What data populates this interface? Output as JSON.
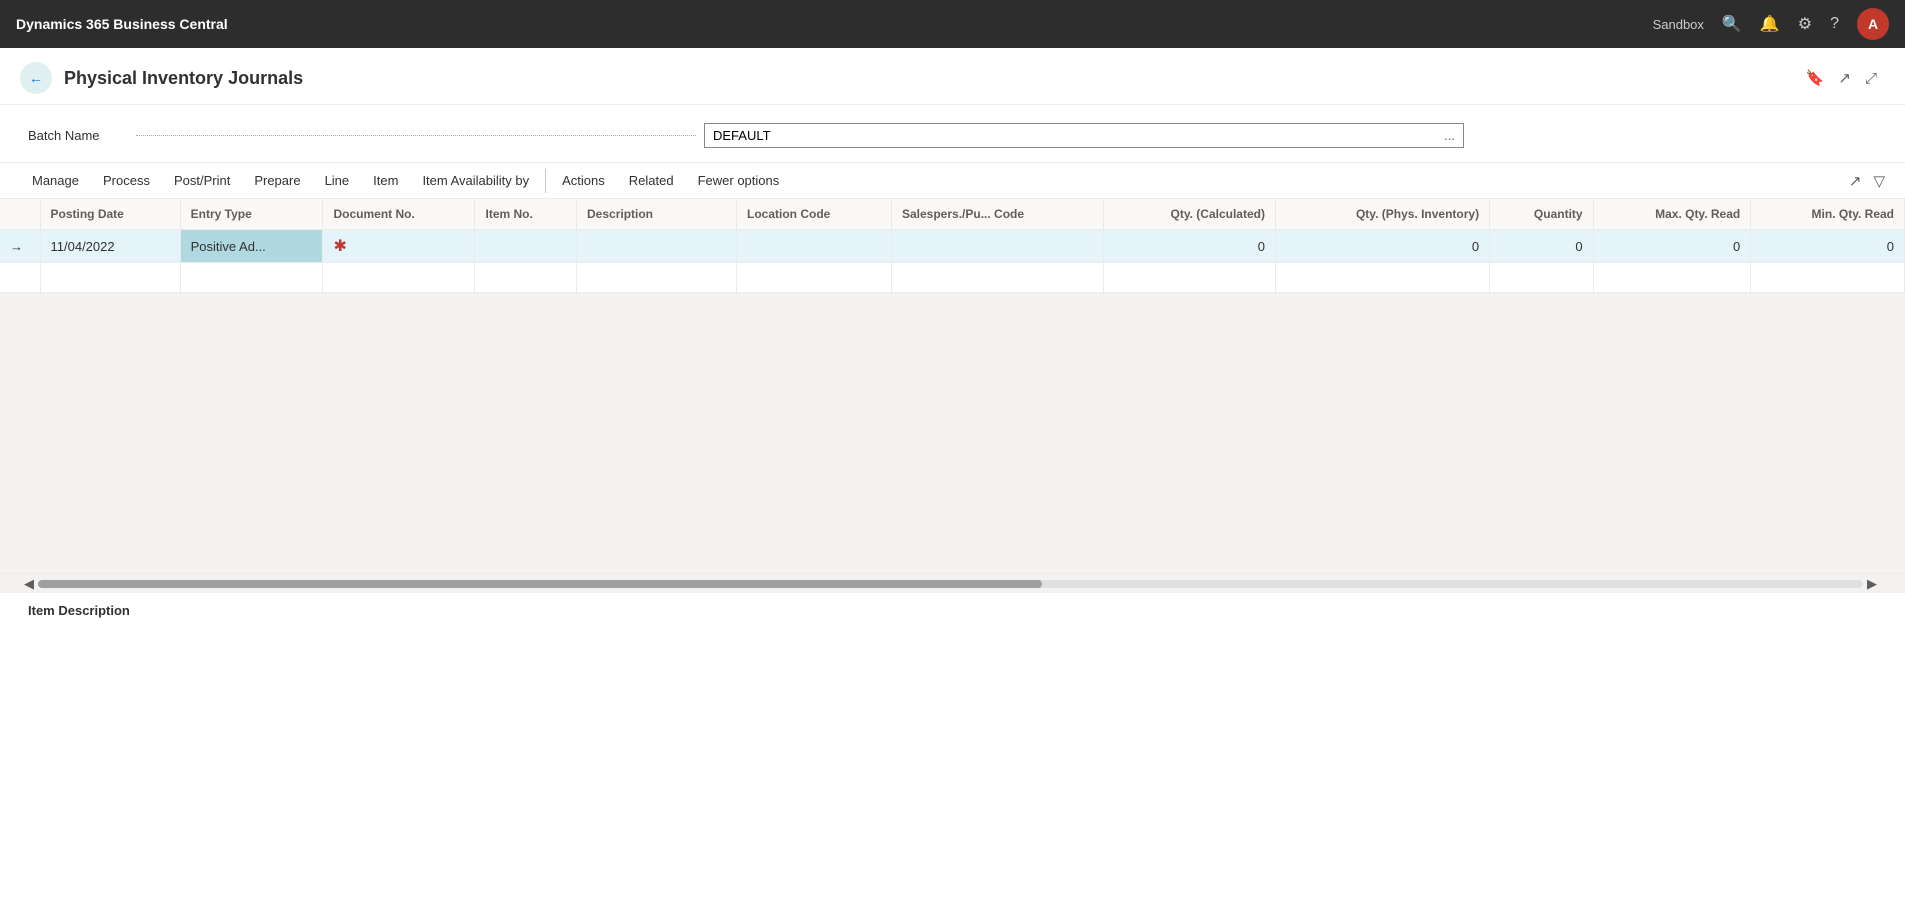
{
  "topbar": {
    "brand": "Dynamics 365 Business Central",
    "sandbox_label": "Sandbox",
    "avatar_letter": "A"
  },
  "page": {
    "title": "Physical Inventory Journals",
    "back_label": "←"
  },
  "batch": {
    "label": "Batch Name",
    "value": "DEFAULT",
    "ellipsis": "..."
  },
  "toolbar": {
    "items": [
      {
        "id": "manage",
        "label": "Manage"
      },
      {
        "id": "process",
        "label": "Process"
      },
      {
        "id": "postprint",
        "label": "Post/Print"
      },
      {
        "id": "prepare",
        "label": "Prepare"
      },
      {
        "id": "line",
        "label": "Line"
      },
      {
        "id": "item",
        "label": "Item"
      },
      {
        "id": "item-availability",
        "label": "Item Availability by"
      },
      {
        "id": "actions",
        "label": "Actions"
      },
      {
        "id": "related",
        "label": "Related"
      },
      {
        "id": "fewer-options",
        "label": "Fewer options"
      }
    ]
  },
  "table": {
    "columns": [
      {
        "id": "arrow",
        "label": ""
      },
      {
        "id": "posting-date",
        "label": "Posting Date"
      },
      {
        "id": "entry-type",
        "label": "Entry Type"
      },
      {
        "id": "document-no",
        "label": "Document No."
      },
      {
        "id": "item-no",
        "label": "Item No."
      },
      {
        "id": "description",
        "label": "Description"
      },
      {
        "id": "location-code",
        "label": "Location Code"
      },
      {
        "id": "salesperson-code",
        "label": "Salespers./Pu... Code"
      },
      {
        "id": "qty-calculated",
        "label": "Qty. (Calculated)"
      },
      {
        "id": "qty-phys-inventory",
        "label": "Qty. (Phys. Inventory)"
      },
      {
        "id": "quantity",
        "label": "Quantity"
      },
      {
        "id": "max-qty-read",
        "label": "Max. Qty. Read"
      },
      {
        "id": "min-qty-read",
        "label": "Min. Qty. Read"
      }
    ],
    "rows": [
      {
        "selected": true,
        "arrow": "→",
        "posting_date": "11/04/2022",
        "entry_type": "Positive Ad...",
        "document_no": "★",
        "item_no": "",
        "description": "",
        "location_code": "",
        "salesperson_code": "",
        "qty_calculated": "0",
        "qty_phys_inventory": "0",
        "quantity": "0",
        "max_qty_read": "0",
        "min_qty_read": "0"
      }
    ]
  },
  "footer": {
    "label": "Item Description"
  }
}
